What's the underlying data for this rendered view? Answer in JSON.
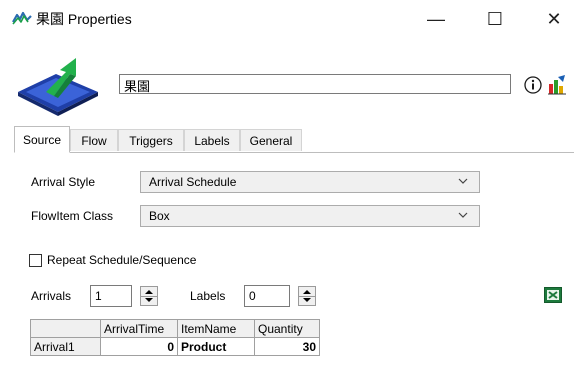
{
  "window": {
    "title": "果園 Properties",
    "minimize_glyph": "—",
    "maximize_glyph": "☐",
    "close_glyph": "✕"
  },
  "object": {
    "name": "果園"
  },
  "tabs": [
    {
      "label": "Source",
      "active": true
    },
    {
      "label": "Flow",
      "active": false
    },
    {
      "label": "Triggers",
      "active": false
    },
    {
      "label": "Labels",
      "active": false
    },
    {
      "label": "General",
      "active": false
    }
  ],
  "source": {
    "arrival_style_label": "Arrival Style",
    "arrival_style_value": "Arrival Schedule",
    "flowitem_class_label": "FlowItem Class",
    "flowitem_class_value": "Box",
    "repeat_label": "Repeat Schedule/Sequence",
    "repeat_checked": false,
    "arrivals_label": "Arrivals",
    "arrivals_value": "1",
    "labels_label": "Labels",
    "labels_value": "0"
  },
  "table": {
    "columns": [
      "ArrivalTime",
      "ItemName",
      "Quantity"
    ],
    "rows": [
      {
        "header": "Arrival1",
        "cells": [
          "0",
          "Product",
          "30"
        ]
      }
    ]
  },
  "icons": {
    "app": "flexsim-app-icon",
    "object": "source-object-icon",
    "info": "info-icon",
    "stats": "statistics-chart-icon",
    "excel": "excel-import-icon"
  }
}
